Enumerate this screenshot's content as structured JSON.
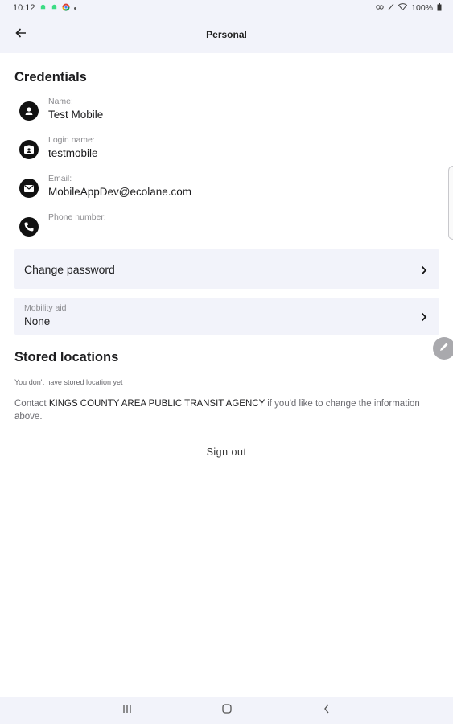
{
  "status_bar": {
    "time": "10:12",
    "battery": "100%",
    "notification_icons": [
      "android-icon",
      "android-icon",
      "chrome-icon",
      "dot-icon"
    ],
    "system_icons": [
      "link-icon",
      "no-sim-icon",
      "wifi-icon",
      "battery-icon"
    ]
  },
  "app_bar": {
    "title": "Personal",
    "back_icon": "arrow-left-icon"
  },
  "credentials": {
    "title": "Credentials",
    "items": [
      {
        "label": "Name:",
        "value": "Test Mobile",
        "icon": "person-icon"
      },
      {
        "label": "Login name:",
        "value": "testmobile",
        "icon": "id-card-icon"
      },
      {
        "label": "Email:",
        "value": "MobileAppDev@ecolane.com",
        "icon": "mail-icon"
      },
      {
        "label": "Phone number:",
        "value": "",
        "icon": "phone-icon"
      }
    ]
  },
  "change_password": {
    "label": "Change password",
    "icon": "chevron-right-icon"
  },
  "mobility_aid": {
    "label": "Mobility aid",
    "value": "None",
    "icon": "chevron-right-icon"
  },
  "stored_locations": {
    "title": "Stored locations",
    "empty_text": "You don't have stored location yet"
  },
  "contact": {
    "prefix": "Contact ",
    "agency": "KINGS COUNTY AREA PUBLIC TRANSIT AGENCY",
    "suffix": " if you'd like to change the information above."
  },
  "sign_out": {
    "label": "Sign out"
  },
  "colors": {
    "header_bg": "#f2f3fa",
    "card_bg": "#f2f3fa",
    "icon_bg": "#111111",
    "label_gray": "#8a8a8e",
    "fab_gray": "#a9a9ad"
  }
}
